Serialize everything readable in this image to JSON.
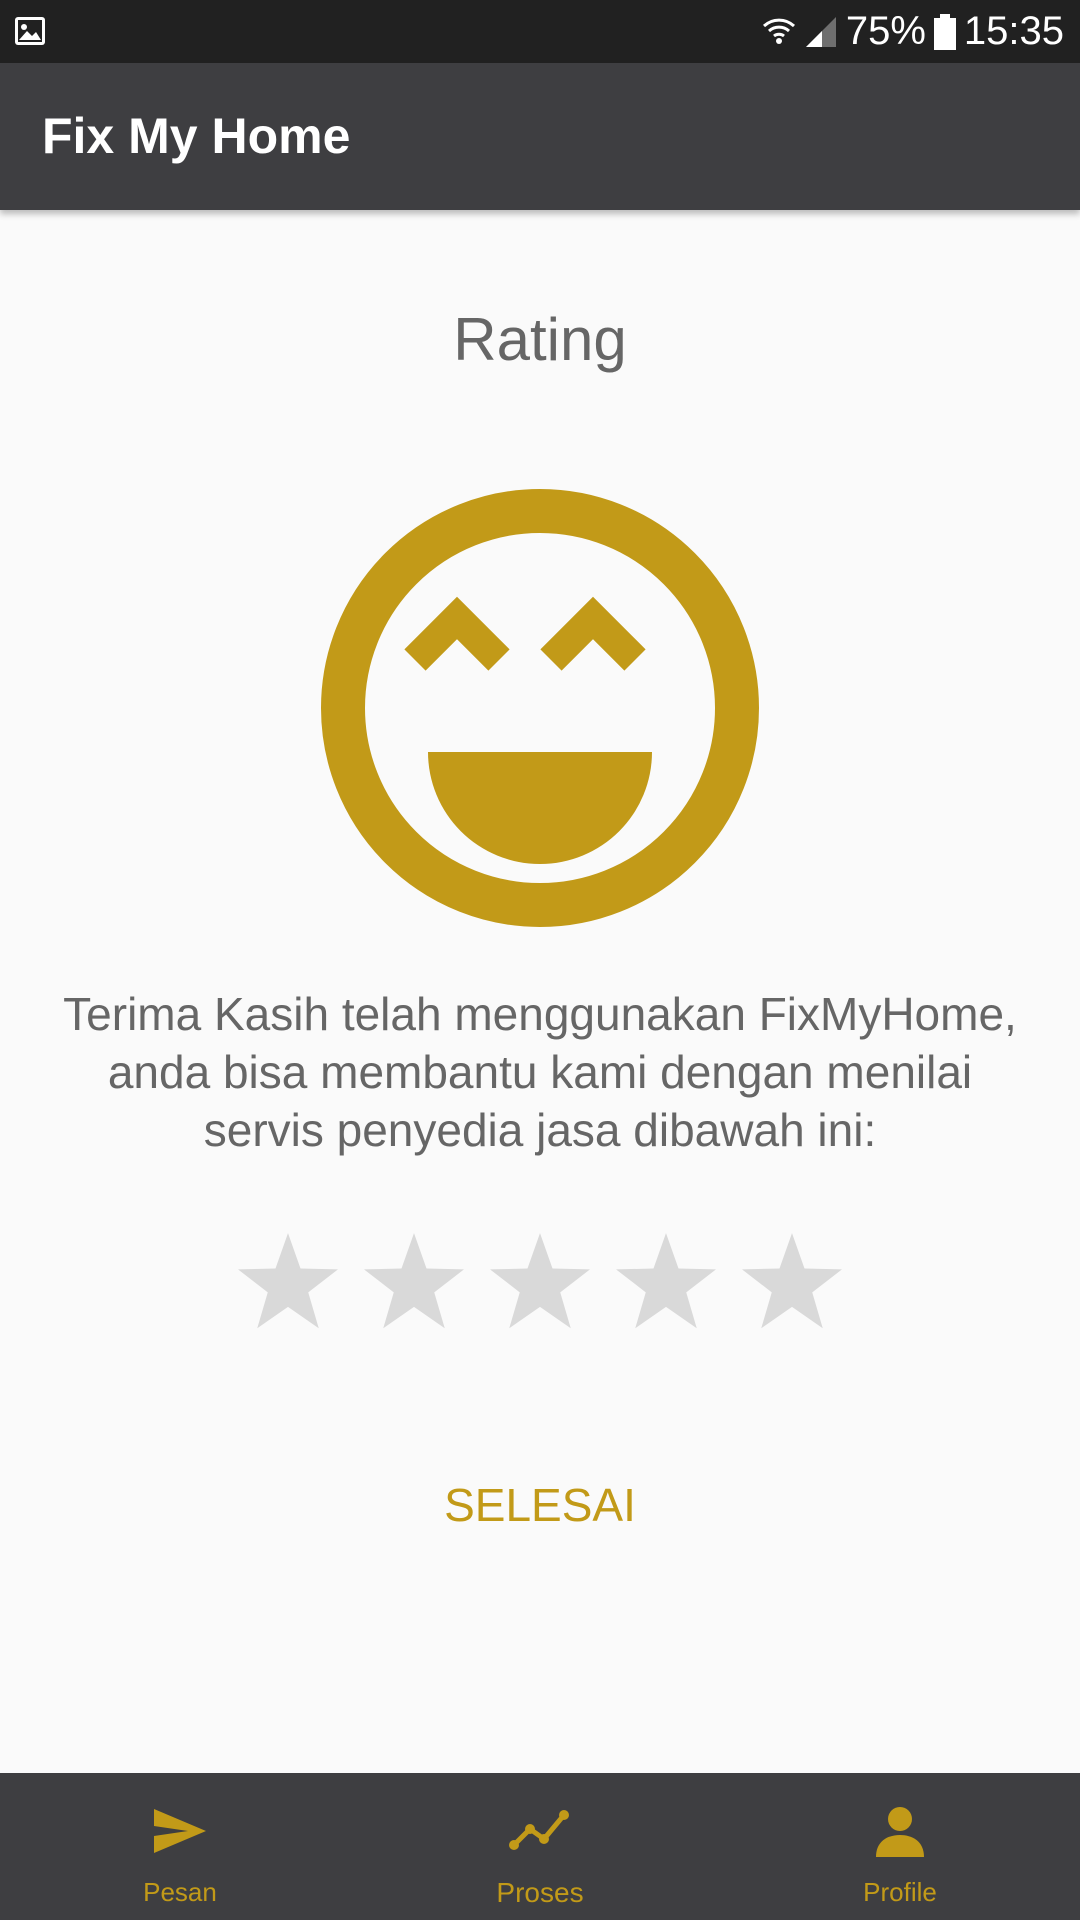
{
  "status_bar": {
    "battery_percent": "75%",
    "time": "15:35",
    "icons": [
      "image-icon",
      "wifi-icon",
      "signal-icon",
      "battery-icon"
    ]
  },
  "app_bar": {
    "title": "Fix My Home"
  },
  "main": {
    "title": "Rating",
    "emoji_icon": "happy-face-icon",
    "message_lines": [
      "Terima Kasih telah menggunakan FixMyHome,",
      "anda bisa membantu kami dengan menilai",
      "servis penyedia jasa dibawah ini:"
    ],
    "rating": {
      "value": 0,
      "max": 5
    },
    "finish_label": "SELESAI"
  },
  "bottom_nav": {
    "items": [
      {
        "label": "Pesan",
        "icon": "send-icon"
      },
      {
        "label": "Proses",
        "icon": "trending-icon",
        "active": true
      },
      {
        "label": "Profile",
        "icon": "person-icon"
      }
    ]
  },
  "colors": {
    "accent": "#c29a18",
    "bar_background": "#3e3e41",
    "status_bar": "#212121",
    "background": "#fafafa",
    "star_empty": "#d9d9d9",
    "text_gray": "#666666"
  }
}
